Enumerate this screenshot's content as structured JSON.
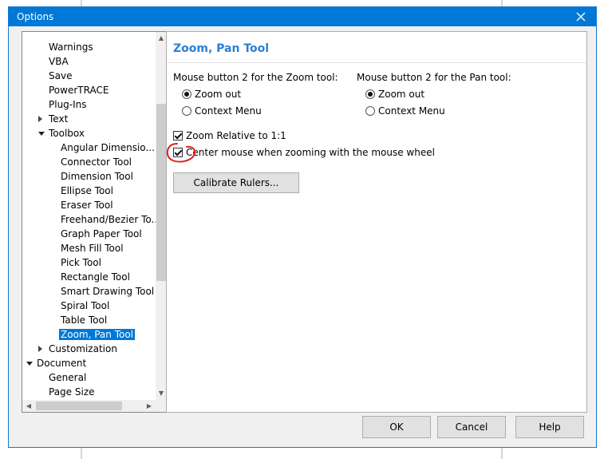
{
  "window": {
    "title": "Options"
  },
  "tree": {
    "items": [
      {
        "label": "Warnings",
        "indent": 2,
        "twisty": "none",
        "selected": false
      },
      {
        "label": "VBA",
        "indent": 2,
        "twisty": "none",
        "selected": false
      },
      {
        "label": "Save",
        "indent": 2,
        "twisty": "none",
        "selected": false
      },
      {
        "label": "PowerTRACE",
        "indent": 2,
        "twisty": "none",
        "selected": false
      },
      {
        "label": "Plug-Ins",
        "indent": 2,
        "twisty": "none",
        "selected": false
      },
      {
        "label": "Text",
        "indent": 2,
        "twisty": "collapsed",
        "selected": false
      },
      {
        "label": "Toolbox",
        "indent": 2,
        "twisty": "expanded",
        "selected": false
      },
      {
        "label": "Angular Dimensio...",
        "indent": 3,
        "twisty": "none",
        "selected": false
      },
      {
        "label": "Connector Tool",
        "indent": 3,
        "twisty": "none",
        "selected": false
      },
      {
        "label": "Dimension Tool",
        "indent": 3,
        "twisty": "none",
        "selected": false
      },
      {
        "label": "Ellipse Tool",
        "indent": 3,
        "twisty": "none",
        "selected": false
      },
      {
        "label": "Eraser Tool",
        "indent": 3,
        "twisty": "none",
        "selected": false
      },
      {
        "label": "Freehand/Bezier To...",
        "indent": 3,
        "twisty": "none",
        "selected": false
      },
      {
        "label": "Graph Paper Tool",
        "indent": 3,
        "twisty": "none",
        "selected": false
      },
      {
        "label": "Mesh Fill Tool",
        "indent": 3,
        "twisty": "none",
        "selected": false
      },
      {
        "label": "Pick Tool",
        "indent": 3,
        "twisty": "none",
        "selected": false
      },
      {
        "label": "Rectangle Tool",
        "indent": 3,
        "twisty": "none",
        "selected": false
      },
      {
        "label": "Smart Drawing Tool",
        "indent": 3,
        "twisty": "none",
        "selected": false
      },
      {
        "label": "Spiral Tool",
        "indent": 3,
        "twisty": "none",
        "selected": false
      },
      {
        "label": "Table Tool",
        "indent": 3,
        "twisty": "none",
        "selected": false
      },
      {
        "label": "Zoom, Pan Tool",
        "indent": 3,
        "twisty": "none",
        "selected": true
      },
      {
        "label": "Customization",
        "indent": 2,
        "twisty": "collapsed",
        "selected": false
      },
      {
        "label": "Document",
        "indent": 1,
        "twisty": "expanded",
        "selected": false
      },
      {
        "label": "General",
        "indent": 2,
        "twisty": "none",
        "selected": false
      },
      {
        "label": "Page Size",
        "indent": 2,
        "twisty": "none",
        "selected": false
      }
    ]
  },
  "panel": {
    "heading": "Zoom, Pan Tool",
    "zoom_group": {
      "label": "Mouse button 2 for the Zoom tool:",
      "options": [
        {
          "label": "Zoom out",
          "selected": true
        },
        {
          "label": "Context Menu",
          "selected": false
        }
      ]
    },
    "pan_group": {
      "label": "Mouse button 2 for the Pan tool:",
      "options": [
        {
          "label": "Zoom out",
          "selected": true
        },
        {
          "label": "Context Menu",
          "selected": false
        }
      ]
    },
    "checkboxes": [
      {
        "label": "Zoom Relative to 1:1",
        "checked": true
      },
      {
        "label": "Center mouse when zooming with the mouse wheel",
        "checked": true
      }
    ],
    "calibrate_label": "Calibrate Rulers..."
  },
  "footer": {
    "ok_label": "OK",
    "cancel_label": "Cancel",
    "help_label": "Help"
  },
  "colors": {
    "titlebar": "#0078d7",
    "heading": "#2b7fd3",
    "selection": "#0078d7",
    "annotation": "#e02020"
  },
  "icons": {
    "close": "close-icon",
    "twisty_collapsed": "triangle-right-icon",
    "twisty_expanded": "triangle-down-icon"
  }
}
